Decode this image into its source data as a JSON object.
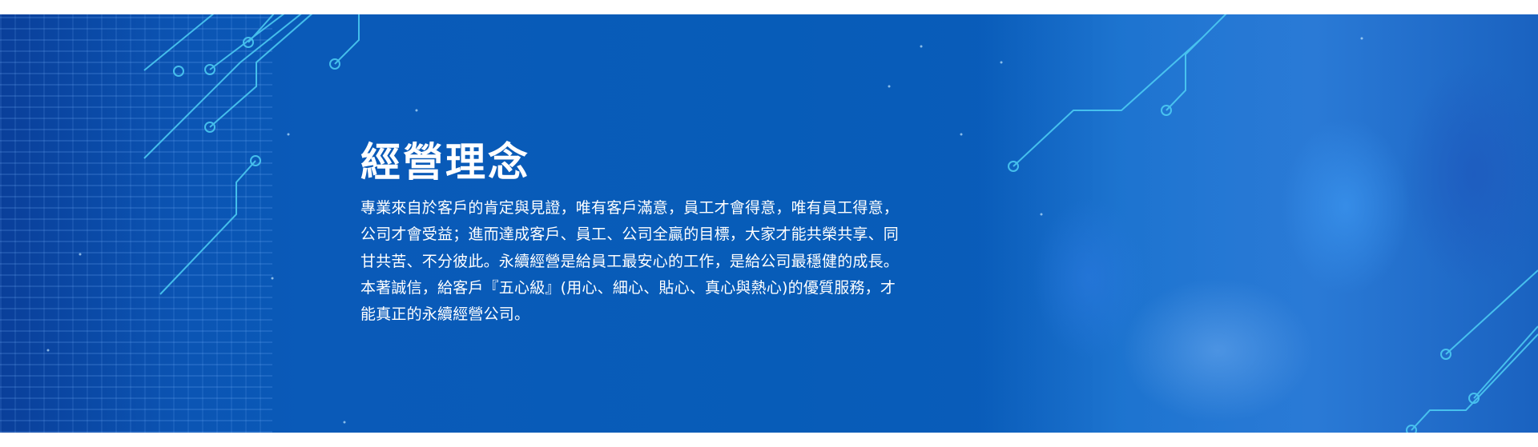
{
  "section": {
    "title": "經營理念",
    "paragraph_lines": [
      "專業來自於客戶的肯定與見證，唯有客戶滿意，員工才會得意，唯有員工得意，",
      "公司才會受益；進而達成客戶、員工、公司全贏的目標，大家才能共榮共享、同",
      "甘共苦、不分彼此。永續經營是給員工最安心的工作，是給公司最穩健的成長。",
      "本著誠信，給客戶『五心級』(用心、細心、貼心、真心與熱心)的優質服務，才",
      "能真正的永續經營公司。"
    ]
  },
  "colors": {
    "banner": "#075cb8",
    "circuit": "#4fd0f5",
    "text": "#ffffff"
  }
}
